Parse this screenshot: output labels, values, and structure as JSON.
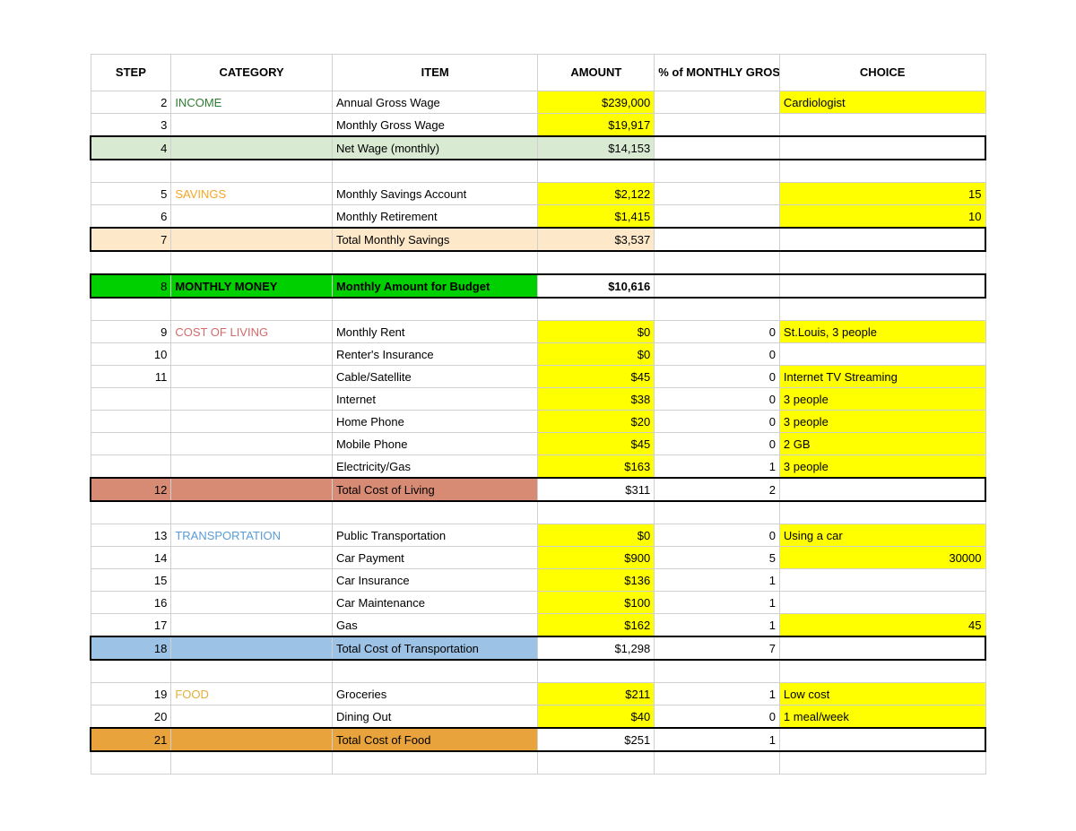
{
  "headers": {
    "step": "STEP",
    "category": "CATEGORY",
    "item": "ITEM",
    "amount": "AMOUNT",
    "pct": "% of MONTHLY GROSS",
    "choice": "CHOICE"
  },
  "rows": [
    {
      "step": "2",
      "category": "INCOME",
      "catClass": "cat-income",
      "item": "Annual Gross Wage",
      "amount": "$239,000",
      "amountHL": true,
      "pct": "",
      "choice": "Cardiologist",
      "choiceHL": true
    },
    {
      "step": "3",
      "category": "",
      "item": "Monthly Gross Wage",
      "amount": "$19,917",
      "amountHL": true,
      "pct": "",
      "choice": ""
    },
    {
      "box": true,
      "fill": "fill-lightgreen",
      "step": "4",
      "category": "",
      "item": "Net Wage (monthly)",
      "amount": "$14,153",
      "amountHL": true,
      "pct": "",
      "choice": ""
    },
    {
      "blank": true
    },
    {
      "step": "5",
      "category": "SAVINGS",
      "catClass": "cat-savings",
      "item": "Monthly Savings Account",
      "amount": "$2,122",
      "amountHL": true,
      "pct": "",
      "choice": "15",
      "choiceHL": true,
      "choiceRight": true
    },
    {
      "step": "6",
      "category": "",
      "item": "Monthly Retirement",
      "amount": "$1,415",
      "amountHL": true,
      "pct": "",
      "choice": "10",
      "choiceHL": true,
      "choiceRight": true
    },
    {
      "box": true,
      "fill": "fill-cream",
      "step": "7",
      "category": "",
      "item": "Total Monthly Savings",
      "amount": "$3,537",
      "pct": "",
      "choice": ""
    },
    {
      "blank": true
    },
    {
      "box": true,
      "fill": "fill-brightgreen",
      "step": "8",
      "category": "MONTHLY MONEY",
      "catClass": "cat-money",
      "item": "Monthly Amount for Budget",
      "itemBold": true,
      "amount": "$10,616",
      "amountBold": true,
      "amountWhite": true,
      "pct": "",
      "choice": ""
    },
    {
      "blank": true
    },
    {
      "step": "9",
      "category": "COST OF LIVING",
      "catClass": "cat-living",
      "item": "Monthly Rent",
      "amount": "$0",
      "amountHL": true,
      "pct": "0",
      "choice": "St.Louis, 3 people",
      "choiceHL": true
    },
    {
      "step": "10",
      "category": "",
      "item": "Renter's Insurance",
      "amount": "$0",
      "amountHL": true,
      "pct": "0",
      "choice": ""
    },
    {
      "step": "11",
      "category": "",
      "item": "Cable/Satellite",
      "amount": "$45",
      "amountHL": true,
      "pct": "0",
      "choice": "Internet TV Streaming",
      "choiceHL": true
    },
    {
      "step": "",
      "category": "",
      "item": "Internet",
      "amount": "$38",
      "amountHL": true,
      "pct": "0",
      "choice": "3 people",
      "choiceHL": true
    },
    {
      "step": "",
      "category": "",
      "item": "Home Phone",
      "amount": "$20",
      "amountHL": true,
      "pct": "0",
      "choice": "3 people",
      "choiceHL": true
    },
    {
      "step": "",
      "category": "",
      "item": "Mobile Phone",
      "amount": "$45",
      "amountHL": true,
      "pct": "0",
      "choice": "2 GB",
      "choiceHL": true
    },
    {
      "step": "",
      "category": "",
      "item": "Electricity/Gas",
      "amount": "$163",
      "amountHL": true,
      "pct": "1",
      "choice": "3 people",
      "choiceHL": true
    },
    {
      "box": true,
      "fill": "fill-salmon",
      "step": "12",
      "category": "",
      "item": "Total Cost of Living",
      "amount": "$311",
      "amountWhite": true,
      "pct": "2",
      "pctWhite": true,
      "choice": ""
    },
    {
      "blank": true
    },
    {
      "step": "13",
      "category": "TRANSPORTATION",
      "catClass": "cat-transport",
      "item": "Public Transportation",
      "amount": "$0",
      "amountHL": true,
      "pct": "0",
      "choice": "Using a car",
      "choiceHL": true
    },
    {
      "step": "14",
      "category": "",
      "item": "Car Payment",
      "amount": "$900",
      "amountHL": true,
      "pct": "5",
      "choice": "30000",
      "choiceHL": true,
      "choiceRight": true
    },
    {
      "step": "15",
      "category": "",
      "item": "Car Insurance",
      "amount": "$136",
      "amountHL": true,
      "pct": "1",
      "choice": ""
    },
    {
      "step": "16",
      "category": "",
      "item": "Car Maintenance",
      "amount": "$100",
      "amountHL": true,
      "pct": "1",
      "choice": ""
    },
    {
      "step": "17",
      "category": "",
      "item": "Gas",
      "amount": "$162",
      "amountHL": true,
      "pct": "1",
      "choice": "45",
      "choiceHL": true,
      "choiceRight": true
    },
    {
      "box": true,
      "fill": "fill-blue",
      "step": "18",
      "category": "",
      "item": "Total Cost of Transportation",
      "amount": "$1,298",
      "amountWhite": true,
      "pct": "7",
      "pctWhite": true,
      "choice": ""
    },
    {
      "blank": true
    },
    {
      "step": "19",
      "category": "FOOD",
      "catClass": "cat-food",
      "item": "Groceries",
      "amount": "$211",
      "amountHL": true,
      "pct": "1",
      "choice": "Low cost",
      "choiceHL": true
    },
    {
      "step": "20",
      "category": "",
      "item": "Dining Out",
      "amount": "$40",
      "amountHL": true,
      "pct": "0",
      "choice": "1 meal/week",
      "choiceHL": true
    },
    {
      "box": true,
      "fill": "fill-orange",
      "step": "21",
      "category": "",
      "item": "Total Cost of Food",
      "amount": "$251",
      "amountWhite": true,
      "pct": "1",
      "pctWhite": true,
      "choice": ""
    },
    {
      "blank": true
    }
  ]
}
